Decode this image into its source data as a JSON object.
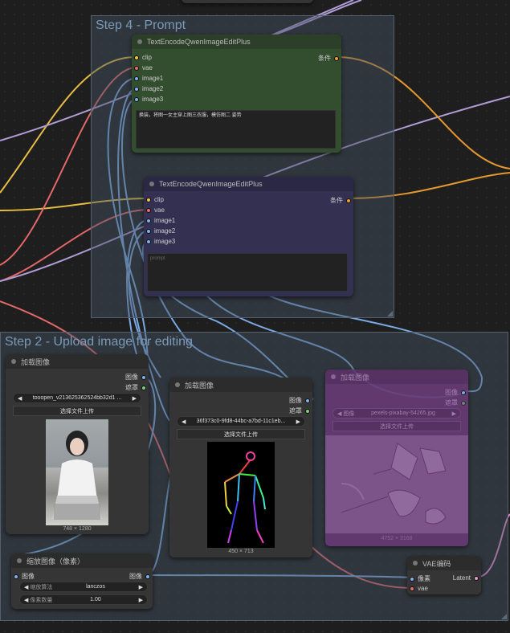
{
  "groups": {
    "prompt": {
      "title": "Step 4 - Prompt"
    },
    "upload": {
      "title": "Step 2 - Upload image for editing"
    }
  },
  "nodes": {
    "encode1": {
      "title": "TextEncodeQwenImageEditPlus",
      "inputs": [
        "clip",
        "vae",
        "image1",
        "image2",
        "image3"
      ],
      "output": "条件",
      "prompt": "换装，将图一女主穿上图三衣服，模仿图二 姿势"
    },
    "encode2": {
      "title": "TextEncodeQwenImageEditPlus",
      "inputs": [
        "clip",
        "vae",
        "image1",
        "image2",
        "image3"
      ],
      "output": "条件",
      "placeholder": "prompt"
    },
    "load1": {
      "title": "加载图像",
      "out_image": "图像",
      "out_mask": "遮罩",
      "file": "tooopen_v213625362524bb32d1 ...",
      "upload_label": "选择文件上传",
      "size": "748 × 1280"
    },
    "load2": {
      "title": "加载图像",
      "out_image": "图像",
      "out_mask": "遮罩",
      "file": "36f373c0-9fd8-44bc-a7bd-11c1eb...",
      "upload_label": "选择文件上传",
      "size": "450 × 713"
    },
    "load3": {
      "title": "加载图像",
      "out_image": "图像",
      "out_mask": "遮罩",
      "file_label": "图像",
      "file": "pexels-pixabay-54265.jpg",
      "upload_label": "选择文件上传",
      "size": "4752 × 3168"
    },
    "scale": {
      "title": "缩放图像（像素）",
      "input": "图像",
      "output": "图像",
      "method_label": "缩放算法",
      "method": "lanczos",
      "megapixels_label": "像素数量",
      "megapixels": "1.00"
    },
    "vae": {
      "title": "VAE编码",
      "input_pixels": "像素",
      "input_vae": "vae",
      "output": "Latent"
    }
  },
  "colors": {
    "canvas": "#1e1e1e",
    "encode1_body": "#334d2f",
    "encode2_body": "#333052",
    "node_body": "#353535",
    "load3_body": "#6a3a78",
    "wire_yellow": "#f2c744",
    "wire_red": "#ef6c6c",
    "wire_blue": "#7fb2ef",
    "wire_orange": "#f0a030",
    "wire_purple": "#b8a3e0",
    "wire_pink": "#f28fd9"
  }
}
